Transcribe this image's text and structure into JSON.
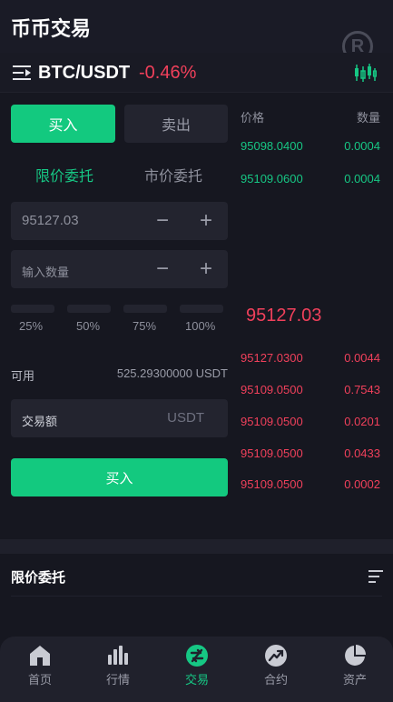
{
  "header": {
    "title": "币币交易",
    "watermark": "R"
  },
  "pair": {
    "symbol": "BTC/USDT",
    "change": "-0.46%"
  },
  "trade": {
    "buy_tab": "买入",
    "sell_tab": "卖出",
    "limit_order": "限价委托",
    "market_order": "市价委托",
    "price_value": "95127.03",
    "qty_placeholder": "输入数量",
    "minus": "−",
    "plus": "+",
    "percents": [
      "25%",
      "50%",
      "75%",
      "100%"
    ],
    "available_label": "可用",
    "available_value": "525.29300000 USDT",
    "amount_label": "交易额",
    "amount_unit": "USDT",
    "submit": "买入"
  },
  "orderbook": {
    "price_header": "价格",
    "qty_header": "数量",
    "bids": [
      {
        "price": "95098.0400",
        "qty": "0.0004"
      },
      {
        "price": "95109.0600",
        "qty": "0.0004"
      }
    ],
    "last_price": "95127.03",
    "asks": [
      {
        "price": "95127.0300",
        "qty": "0.0044"
      },
      {
        "price": "95109.0500",
        "qty": "0.7543"
      },
      {
        "price": "95109.0500",
        "qty": "0.0201"
      },
      {
        "price": "95109.0500",
        "qty": "0.0433"
      },
      {
        "price": "95109.0500",
        "qty": "0.0002"
      }
    ]
  },
  "orders_section": {
    "title": "限价委托"
  },
  "nav": {
    "items": [
      {
        "label": "首页",
        "icon": "home-icon"
      },
      {
        "label": "行情",
        "icon": "market-icon"
      },
      {
        "label": "交易",
        "icon": "trade-icon",
        "active": true
      },
      {
        "label": "合约",
        "icon": "contract-icon"
      },
      {
        "label": "资产",
        "icon": "assets-icon"
      }
    ]
  },
  "colors": {
    "green": "#16c784",
    "red": "#f0405b",
    "background": "#161720"
  }
}
